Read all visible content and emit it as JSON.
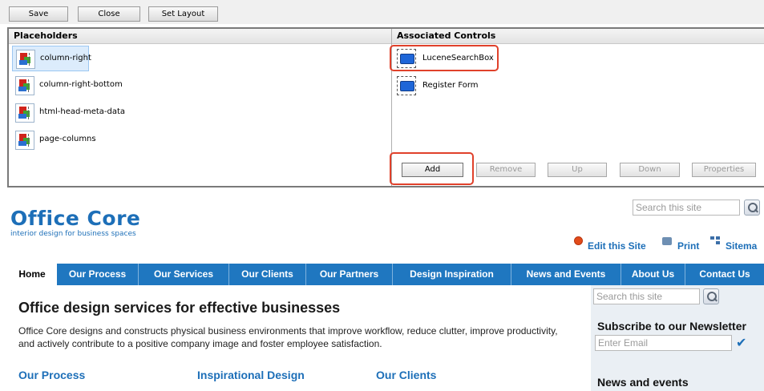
{
  "toolbar": {
    "save_label": "Save",
    "close_label": "Close",
    "set_layout_label": "Set Layout"
  },
  "placeholders": {
    "header": "Placeholders",
    "items": [
      {
        "label": "column-right",
        "selected": true
      },
      {
        "label": "column-right-bottom"
      },
      {
        "label": "html-head-meta-data"
      },
      {
        "label": "page-columns"
      }
    ]
  },
  "associated": {
    "header": "Associated Controls",
    "items": [
      {
        "label": "LuceneSearchBox",
        "highlighted": true
      },
      {
        "label": "Register Form"
      }
    ],
    "buttons": {
      "add": "Add",
      "remove": "Remove",
      "up": "Up",
      "down": "Down",
      "properties": "Properties"
    }
  },
  "site": {
    "logo": "Office Core",
    "tagline": "interior design for business spaces",
    "search_placeholder": "Search this site",
    "actions": {
      "edit": "Edit this Site",
      "print": "Print",
      "sitemap": "Sitema"
    },
    "nav": [
      "Home",
      "Our Process",
      "Our Services",
      "Our Clients",
      "Our Partners",
      "Design Inspiration",
      "News and Events",
      "About Us",
      "Contact Us"
    ],
    "heading": "Office design services for effective businesses",
    "body": "Office Core designs and constructs physical business environments that improve workflow, reduce clutter, improve productivity, and actively contribute to a positive company image and foster employee satisfaction.",
    "subheads": [
      "Our Process",
      "Inspirational Design",
      "Our Clients"
    ],
    "sidebar": {
      "search_placeholder": "Search this site",
      "newsletter_title": "Subscribe to our Newsletter",
      "email_placeholder": "Enter Email",
      "news_title": "News and events"
    }
  },
  "colors": {
    "brand_blue": "#1d6fb8",
    "nav_blue": "#1f77c0",
    "highlight_red": "#e0412b"
  }
}
